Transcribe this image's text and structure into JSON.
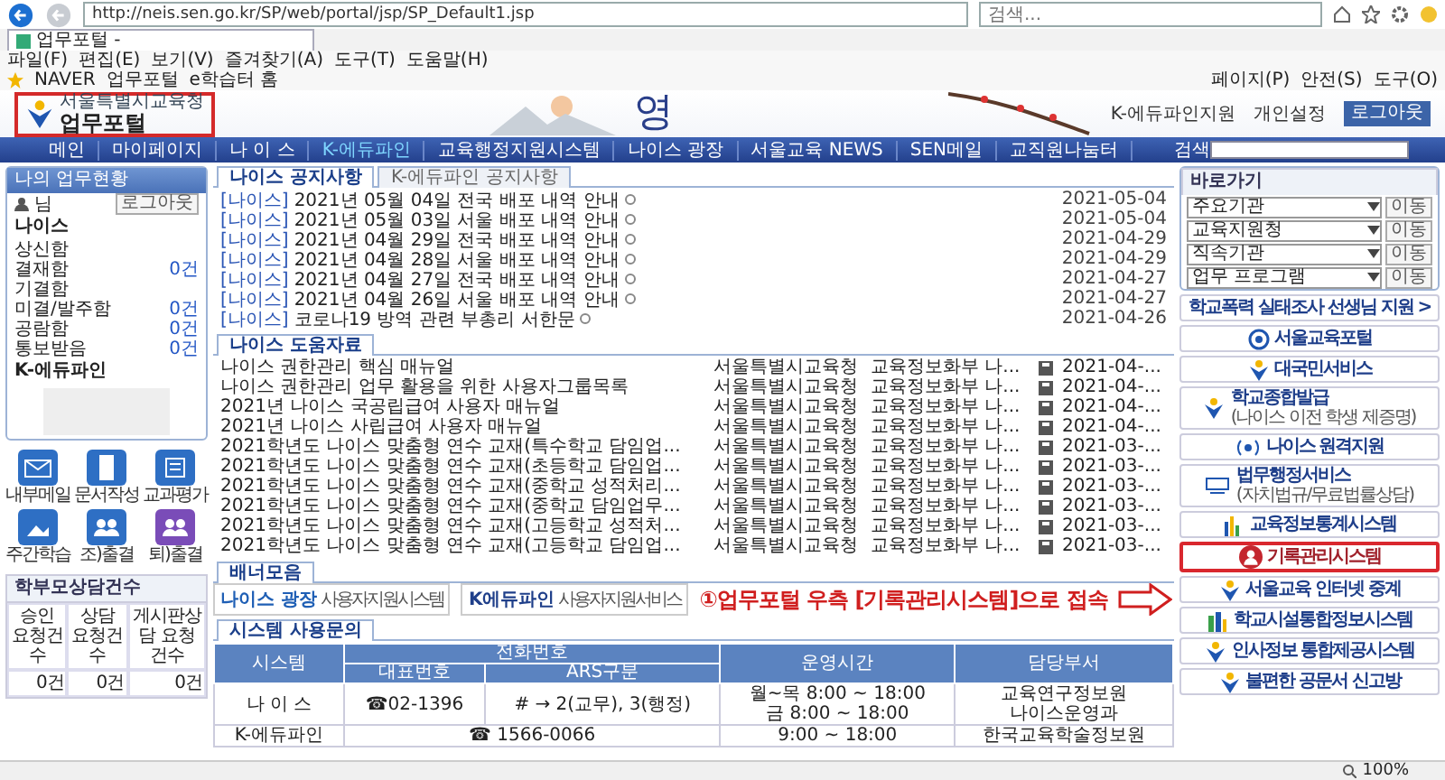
{
  "browser": {
    "url": "http://neis.sen.go.kr/SP/web/portal/jsp/SP_Default1.jsp",
    "search_placeholder": "검색...",
    "tab_title": "업무포털 -",
    "menu": [
      "파일(F)",
      "편집(E)",
      "보기(V)",
      "즐겨찾기(A)",
      "도구(T)",
      "도움말(H)"
    ],
    "favorites": [
      "NAVER",
      "업무포털",
      "e학습터 홈"
    ],
    "commands": [
      "페이지(P)",
      "안전(S)",
      "도구(O)"
    ]
  },
  "header": {
    "org": "서울특별시교육청",
    "title": "업무포털",
    "calligraphy": "영",
    "links": [
      "K-에듀파인지원",
      "개인설정"
    ],
    "logout": "로그아웃"
  },
  "nav": {
    "items": [
      {
        "label": "메인",
        "selected": false
      },
      {
        "label": "마이페이지",
        "selected": false
      },
      {
        "label": "나 이 스",
        "selected": false
      },
      {
        "label": "K-에듀파인",
        "selected": true
      },
      {
        "label": "교육행정지원시스템",
        "selected": false
      },
      {
        "label": "나이스 광장",
        "selected": false
      },
      {
        "label": "서울교육 NEWS",
        "selected": false
      },
      {
        "label": "SEN메일",
        "selected": false
      },
      {
        "label": "교직원나눔터",
        "selected": false
      }
    ],
    "search_label": "검색"
  },
  "status_panel": {
    "title": "나의 업무현황",
    "user_suffix": "님",
    "logout": "로그아웃",
    "neis_label": "나이스",
    "items": [
      {
        "label": "상신함"
      },
      {
        "label": "결재함",
        "count": "0건"
      },
      {
        "label": "기결함"
      },
      {
        "label": "미결/발주함",
        "count": "0건"
      },
      {
        "label": "공람함",
        "count": "0건"
      },
      {
        "label": "통보받음",
        "count": "0건"
      }
    ],
    "edufine_label": "K-에듀파인"
  },
  "quick_icons": [
    {
      "label": "내부메일",
      "kind": "mail"
    },
    {
      "label": "문서작성",
      "kind": "doc"
    },
    {
      "label": "교과평가",
      "kind": "grade"
    },
    {
      "label": "주간학습",
      "kind": "photo"
    },
    {
      "label": "조)출결",
      "kind": "people"
    },
    {
      "label": "퇴)출결",
      "kind": "people2"
    }
  ],
  "counsel": {
    "title": "학부모상담건수",
    "columns": [
      "승인 요청건수",
      "상담 요청건수",
      "게시판상담 요청건수"
    ],
    "values": [
      "0건",
      "0건",
      "0건"
    ]
  },
  "notices": {
    "tabs": [
      {
        "label": "나이스 공지사항",
        "selected": true
      },
      {
        "label": "K-에듀파인 공지사항",
        "selected": false
      }
    ],
    "items": [
      {
        "tag": "[나이스]",
        "title": "2021년 05월 04일 전국 배포 내역 안내",
        "date": "2021-05-04"
      },
      {
        "tag": "[나이스]",
        "title": "2021년 05월 03일 서울 배포 내역 안내",
        "date": "2021-05-04"
      },
      {
        "tag": "[나이스]",
        "title": "2021년 04월 29일 전국 배포 내역 안내",
        "date": "2021-04-29"
      },
      {
        "tag": "[나이스]",
        "title": "2021년 04월 28일 서울 배포 내역 안내",
        "date": "2021-04-29"
      },
      {
        "tag": "[나이스]",
        "title": "2021년 04월 27일 전국 배포 내역 안내",
        "date": "2021-04-27"
      },
      {
        "tag": "[나이스]",
        "title": "2021년 04월 26일 서울 배포 내역 안내",
        "date": "2021-04-27"
      },
      {
        "tag": "[나이스]",
        "title": "코로나19 방역 관련 부총리 서한문",
        "date": "2021-04-26"
      }
    ]
  },
  "resources": {
    "tabs": [
      {
        "label": "나이스 도움자료",
        "selected": true
      }
    ],
    "rows": [
      {
        "title": "나이스 권한관리 핵심 매뉴얼",
        "org": "서울특별시교육청",
        "dept": "교육정보화부 나...",
        "date": "2021-04-..."
      },
      {
        "title": "나이스 권한관리 업무 활용을 위한 사용자그룹목록",
        "org": "서울특별시교육청",
        "dept": "교육정보화부 나...",
        "date": "2021-04-..."
      },
      {
        "title": "2021년 나이스 국공립급여 사용자 매뉴얼",
        "org": "서울특별시교육청",
        "dept": "교육정보화부 나...",
        "date": "2021-04-..."
      },
      {
        "title": "2021년 나이스 사립급여 사용자 매뉴얼",
        "org": "서울특별시교육청",
        "dept": "교육정보화부 나...",
        "date": "2021-04-..."
      },
      {
        "title": "2021학년도 나이스 맞춤형 연수 교재(특수학교 담임업...",
        "org": "서울특별시교육청",
        "dept": "교육정보화부 나...",
        "date": "2021-03-..."
      },
      {
        "title": "2021학년도 나이스 맞춤형 연수 교재(초등학교 담임업...",
        "org": "서울특별시교육청",
        "dept": "교육정보화부 나...",
        "date": "2021-03-..."
      },
      {
        "title": "2021학년도 나이스 맞춤형 연수 교재(중학교 성적처리...",
        "org": "서울특별시교육청",
        "dept": "교육정보화부 나...",
        "date": "2021-03-..."
      },
      {
        "title": "2021학년도 나이스 맞춤형 연수 교재(중학교 담임업무...",
        "org": "서울특별시교육청",
        "dept": "교육정보화부 나...",
        "date": "2021-03-..."
      },
      {
        "title": "2021학년도 나이스 맞춤형 연수 교재(고등학교 성적처...",
        "org": "서울특별시교육청",
        "dept": "교육정보화부 나...",
        "date": "2021-03-..."
      },
      {
        "title": "2021학년도 나이스 맞춤형 연수 교재(고등학교 담임업...",
        "org": "서울특별시교육청",
        "dept": "교육정보화부 나...",
        "date": "2021-03-..."
      }
    ]
  },
  "banners": {
    "tabs": [
      {
        "label": "배너모음",
        "selected": true
      }
    ],
    "items": [
      {
        "title": "나이스 광장",
        "sub": "사용자지원시스템",
        "kind": "neis"
      },
      {
        "title": "K에듀파인",
        "sub": "사용자지원서비스",
        "kind": "edufine"
      }
    ]
  },
  "annotation": "①업무포털 우측 [기록관리시스템]으로 접속",
  "contact": {
    "tabs": [
      {
        "label": "시스템 사용문의",
        "selected": true
      }
    ],
    "columns": [
      "시스템",
      "전화번호",
      "운영시간",
      "담당부서"
    ],
    "subcolumns": [
      "대표번호",
      "ARS구분"
    ],
    "rows": [
      {
        "system": [
          "나 이 스"
        ],
        "phone": "☎02-1396",
        "ars": [
          "# → 2(교무), 3(행정)"
        ],
        "hours": [
          "월~목 8:00 ~ 18:00",
          "금 8:00 ~ 18:00"
        ],
        "dept": [
          "교육연구정보원",
          "나이스운영과"
        ]
      },
      {
        "system": [
          "K-에듀파인"
        ],
        "phone": "☎ 1566-0066",
        "hours": [
          "9:00 ~ 18:00"
        ],
        "dept": [
          "한국교육학술정보원"
        ]
      }
    ]
  },
  "shortcuts": {
    "title": "바로가기",
    "selects": [
      {
        "value": "주요기관",
        "button": "이동"
      },
      {
        "value": "교육지원청",
        "button": "이동"
      },
      {
        "value": "직속기관",
        "button": "이동"
      },
      {
        "value": "업무 프로그램",
        "button": "이동"
      }
    ]
  },
  "links": [
    {
      "title": "학교폭력 실태조사 선생님 지원 >",
      "kind": "text",
      "highlighted": false
    },
    {
      "title": "서울교육포털",
      "kind": "ssem",
      "highlighted": false
    },
    {
      "title": "대국민서비스",
      "kind": "seal",
      "highlighted": false
    },
    {
      "title": "학교종합발급",
      "sub": "(나이스 이전 학생 제증명)",
      "kind": "seal",
      "highlighted": false
    },
    {
      "title": "나이스 원격지원",
      "kind": "remote",
      "highlighted": false
    },
    {
      "title": "법무행정서비스",
      "sub": "(자치법규/무료법률상담)",
      "kind": "law",
      "highlighted": false
    },
    {
      "title": "교육정보통계시스템",
      "kind": "stats",
      "highlighted": false
    },
    {
      "title": "기록관리시스템",
      "kind": "archive",
      "highlighted": true
    },
    {
      "title": "서울교육 인터넷 중계",
      "kind": "seal",
      "highlighted": false
    },
    {
      "title": "학교시설통합정보시스템",
      "kind": "buildings",
      "highlighted": false
    },
    {
      "title": "인사정보 통합제공시스템",
      "kind": "seal",
      "highlighted": false
    },
    {
      "title": "불편한 공문서 신고방",
      "kind": "seal",
      "highlighted": false
    }
  ],
  "status_bar": {
    "zoom": "100%"
  }
}
